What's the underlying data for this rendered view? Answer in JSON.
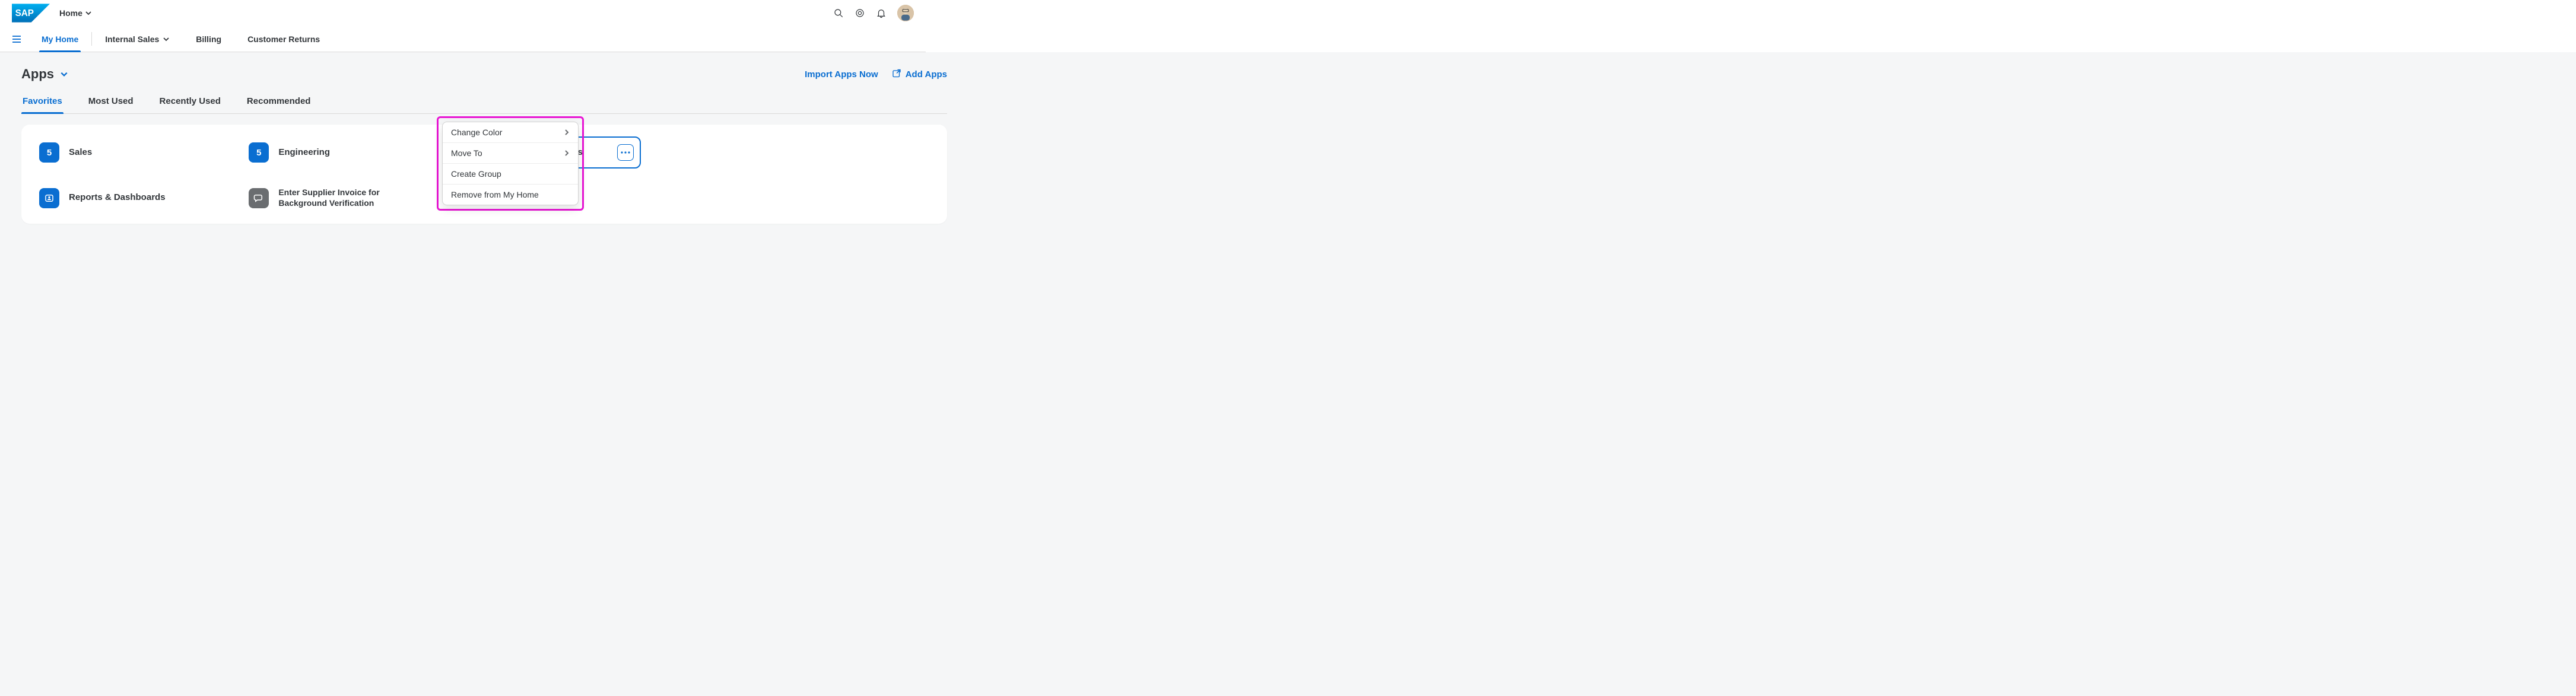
{
  "shellbar": {
    "space_title": "Home",
    "icons": {
      "search": "search",
      "copilot": "copilot",
      "notification": "notification"
    }
  },
  "nav": {
    "items": [
      {
        "label": "My Home",
        "active": true,
        "has_dropdown": false
      },
      {
        "label": "Internal Sales",
        "active": false,
        "has_dropdown": true
      },
      {
        "label": "Billing",
        "active": false,
        "has_dropdown": false
      },
      {
        "label": "Customer Returns",
        "active": false,
        "has_dropdown": false
      }
    ]
  },
  "section": {
    "title": "Apps",
    "actions": {
      "import": "Import Apps Now",
      "add": "Add Apps"
    }
  },
  "tabs": [
    {
      "label": "Favorites",
      "active": true
    },
    {
      "label": "Most Used",
      "active": false
    },
    {
      "label": "Recently Used",
      "active": false
    },
    {
      "label": "Recommended",
      "active": false
    }
  ],
  "tiles": [
    {
      "icon": "count",
      "count": "5",
      "color": "blue",
      "label": "Sales"
    },
    {
      "icon": "count",
      "count": "5",
      "color": "blue",
      "label": "Engineering"
    },
    {
      "icon": "pictures",
      "color": "red",
      "label": "Commercial Projects",
      "selected": true
    },
    {
      "icon": "person-card",
      "color": "blue",
      "label": "Reports & Dashboards"
    },
    {
      "icon": "chat",
      "color": "gray",
      "label": "Enter Supplier Invoice for Background Verification"
    }
  ],
  "popover": {
    "items": [
      {
        "label": "Change Color",
        "submenu": true
      },
      {
        "label": "Move To",
        "submenu": true
      },
      {
        "label": "Create Group",
        "submenu": false
      },
      {
        "label": "Remove from My Home",
        "submenu": false
      }
    ]
  }
}
